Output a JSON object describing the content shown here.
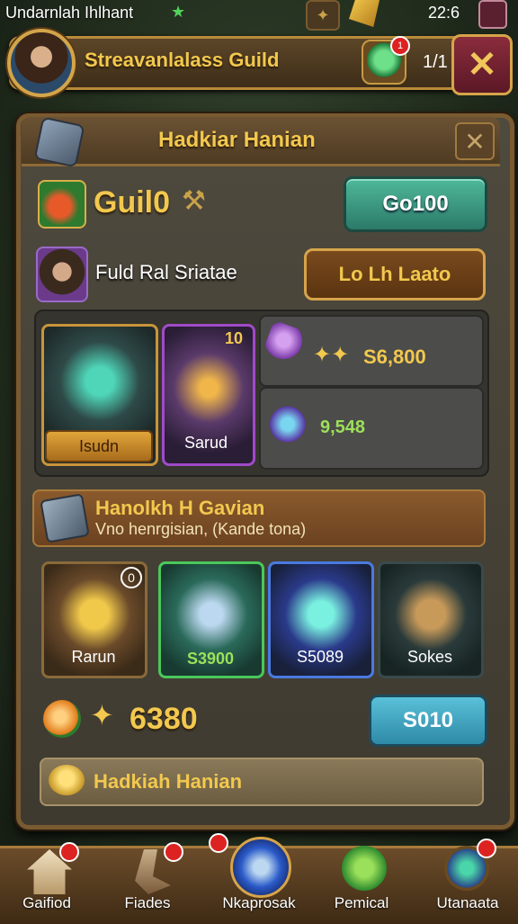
{
  "status_bar": {
    "left_text": "Undarnlah Ihlhant",
    "time": "22:6"
  },
  "header": {
    "guild_name": "Streavanlalass Guild",
    "gem_badge_count": "1",
    "value": "1/1"
  },
  "panel": {
    "title": "Hadkiar Hanian",
    "guild": {
      "label": "Guil0",
      "gold_button": "Go100"
    },
    "raid": {
      "label": "Fuld Ral Sriatae",
      "button": "Lo Lh Laato"
    },
    "items": [
      {
        "label": "Isudn"
      },
      {
        "label": "Sarud",
        "count": "10"
      }
    ],
    "rewards": [
      {
        "stars": "✦✦",
        "value": "S6,800"
      },
      {
        "value": "9,548"
      }
    ],
    "banner": {
      "title": "Hanolkh H Gavian",
      "subtitle": "Vno henrgisian, (Kande tona)"
    },
    "tiles": [
      {
        "label": "Rarun",
        "badge": "0"
      },
      {
        "label": "S3900"
      },
      {
        "label": "S5089"
      },
      {
        "label": "Sokes"
      }
    ],
    "bottom": {
      "amount": "6380",
      "button": "S010"
    },
    "footer_label": "Hadkiah Hanian"
  },
  "nav": [
    {
      "label": "Gaifiod",
      "icon": "home-icon"
    },
    {
      "label": "Fiades",
      "icon": "weapon-icon"
    },
    {
      "label": "Nkaprosak",
      "icon": "compass-icon"
    },
    {
      "label": "Pemical",
      "icon": "gem-icon"
    },
    {
      "label": "Utanaata",
      "icon": "globe-icon"
    }
  ],
  "colors": {
    "gold": "#f2c84e",
    "panel": "#4e4a3e",
    "wood": "#7a5a30",
    "teal_button": "#4fb89a",
    "blue_button": "#5ac0d8",
    "red_badge": "#dd2222"
  }
}
